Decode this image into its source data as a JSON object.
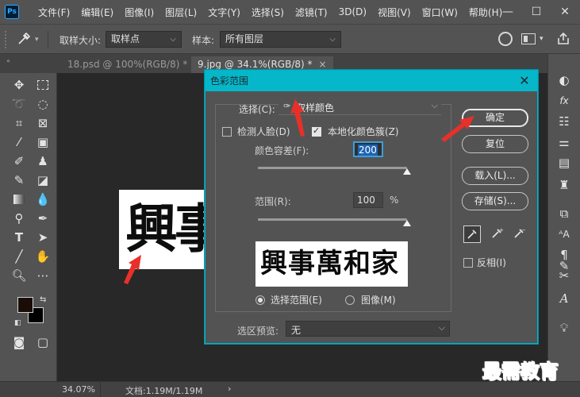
{
  "menu": {
    "logo": "Ps",
    "items": [
      "文件(F)",
      "编辑(E)",
      "图像(I)",
      "图层(L)",
      "文字(Y)",
      "选择(S)",
      "滤镜(T)",
      "3D(D)",
      "视图(V)",
      "窗口(W)",
      "帮助(H)"
    ]
  },
  "options": {
    "sample_size_label": "取样大小:",
    "sample_size_value": "取样点",
    "sample_label": "样本:",
    "sample_value": "所有图层"
  },
  "tabs": [
    {
      "label": "18.psd @ 100%(RGB/8) *"
    },
    {
      "label": "9.jpg @ 34.1%(RGB/8) *"
    }
  ],
  "dialog": {
    "title": "色彩范围",
    "select_label": "选择(C):",
    "select_value": "取样颜色",
    "detect_faces_label": "检测人脸(D)",
    "detect_faces_checked": false,
    "localized_label": "本地化颜色簇(Z)",
    "localized_checked": true,
    "fuzziness_label": "颜色容差(F):",
    "fuzziness_value": "200",
    "fuzziness_level": 1.0,
    "range_label": "范围(R):",
    "range_value": "100",
    "range_unit": "%",
    "range_level": 1.0,
    "preview_text": "興事萬和家",
    "radio_selection_label": "选择范围(E)",
    "radio_image_label": "图像(M)",
    "radio_selected": "selection",
    "selection_preview_label": "选区预览:",
    "selection_preview_value": "无",
    "btn_ok": "确定",
    "btn_reset": "复位",
    "btn_load": "载入(L)...",
    "btn_save": "存储(S)...",
    "invert_label": "反相(I)",
    "invert_checked": false
  },
  "canvas": {
    "image_text": "興事"
  },
  "status": {
    "zoom": "34.07%",
    "doc_info": "文档:1.19M/1.19M",
    "arrow": "›"
  },
  "watermark": "最需教育",
  "colors": {
    "accent": "#06b6c9",
    "arrow_red": "#e8302a",
    "foreground": "#1a0d08",
    "background": "#000000"
  }
}
